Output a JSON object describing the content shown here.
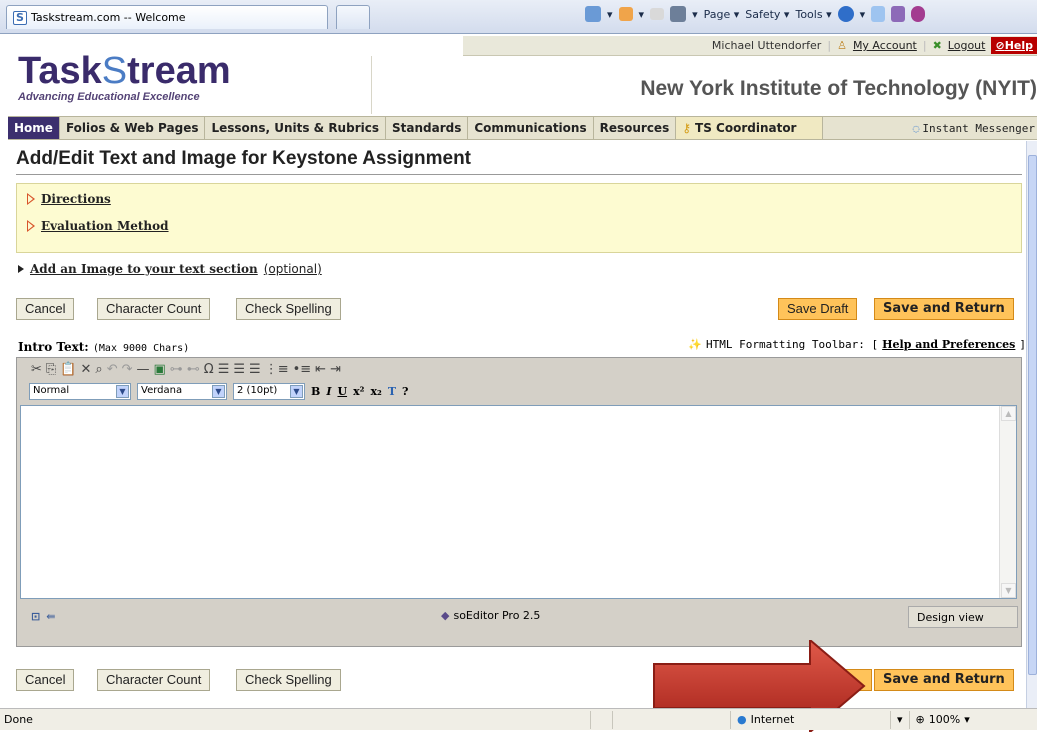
{
  "browser": {
    "tab_title": "Taskstream.com -- Welcome",
    "cmd": {
      "page": "Page ▾",
      "safety": "Safety ▾",
      "tools": "Tools ▾"
    }
  },
  "header": {
    "user": "Michael Uttendorfer",
    "my_account": "My Account",
    "logout": "Logout",
    "help": "Help",
    "logo_a": "Task",
    "logo_s": "S",
    "logo_b": "tream",
    "tagline": "Advancing Educational Excellence",
    "institution": "New York Institute of Technology (NYIT)"
  },
  "nav": {
    "items": [
      "Home",
      "Folios & Web Pages",
      "Lessons, Units & Rubrics",
      "Standards",
      "Communications",
      "Resources",
      "TS Coordinator"
    ],
    "im": "Instant Messenger"
  },
  "page": {
    "title": "Add/Edit Text and Image for Keystone Assignment",
    "directions": "Directions",
    "evaluation": "Evaluation Method",
    "add_image": "Add an Image to your text section",
    "optional": "(optional)",
    "buttons": {
      "cancel": "Cancel",
      "char_count": "Character Count",
      "check_spelling": "Check Spelling",
      "save_draft": "Save Draft",
      "save_return": "Save and Return"
    },
    "intro_label": "Intro Text:",
    "intro_max": "(Max 9000 Chars)",
    "fmt_label": "HTML Formatting Toolbar: [",
    "fmt_link": "Help and Preferences",
    "fmt_end": "]"
  },
  "editor": {
    "style": "Normal",
    "font": "Verdana",
    "size": "2 (10pt)",
    "brand": "soEditor Pro 2.5",
    "view": "Design view"
  },
  "status": {
    "left": "Done",
    "zone": "Internet",
    "zoom": "100%"
  },
  "colors": {
    "accent": "#3c2f6e",
    "save": "#ffc35a",
    "arrow": "#c0392b"
  }
}
